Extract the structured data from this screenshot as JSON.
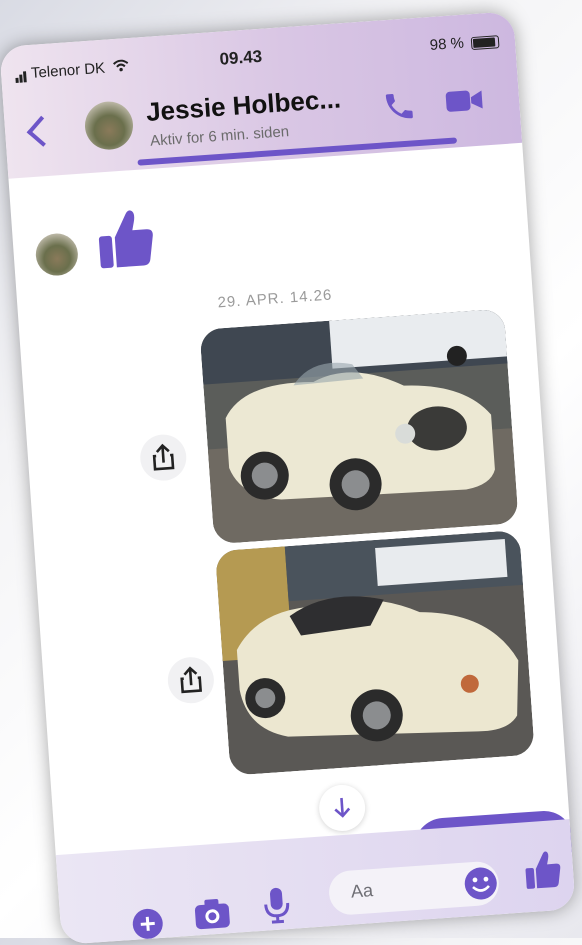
{
  "status_bar": {
    "carrier": "Telenor DK",
    "time": "09.43",
    "battery": "98 %"
  },
  "header": {
    "contact_name": "Jessie Holbec...",
    "activity": "Aktiv for 6 min. siden"
  },
  "conversation": {
    "timestamp": "29. APR. 14.26",
    "photos": [
      {
        "description": "Cream convertible sports car, front three-quarter view"
      },
      {
        "description": "Cream convertible sports car, rear three-quarter view"
      }
    ]
  },
  "composer": {
    "placeholder": "Aa"
  },
  "icons": [
    "back-icon",
    "phone-icon",
    "video-icon",
    "thumbs-up-icon",
    "share-icon",
    "arrow-down-icon",
    "plus-icon",
    "camera-icon",
    "microphone-icon",
    "emoji-icon"
  ],
  "colors": {
    "accent": "#6d55c8",
    "header_bg": "#d9c6e4",
    "composer_bg": "#e4dcf2"
  }
}
